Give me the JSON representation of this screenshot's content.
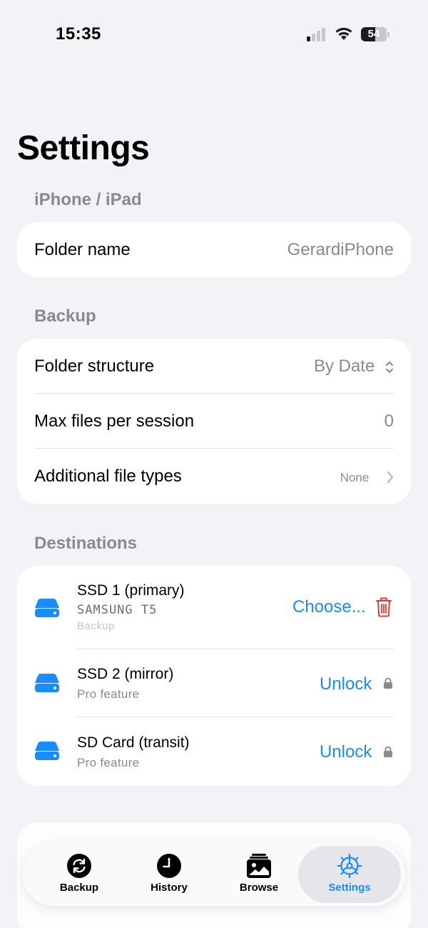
{
  "status_bar": {
    "time": "15:35",
    "battery_level": "54"
  },
  "title": "Settings",
  "sections": {
    "device": {
      "header": "iPhone / iPad",
      "folder_name_label": "Folder name",
      "folder_name_value": "GerardiPhone"
    },
    "backup": {
      "header": "Backup",
      "folder_structure_label": "Folder structure",
      "folder_structure_value": "By Date",
      "max_files_label": "Max files per session",
      "max_files_value": "0",
      "file_types_label": "Additional file types",
      "file_types_value": "None"
    },
    "destinations": {
      "header": "Destinations",
      "items": [
        {
          "name": "SSD 1 (primary)",
          "model": "SAMSUNG T5",
          "role": "Backup",
          "action": "Choose..."
        },
        {
          "name": "SSD 2 (mirror)",
          "sub": "Pro feature",
          "action": "Unlock"
        },
        {
          "name": "SD Card (transit)",
          "sub": "Pro feature",
          "action": "Unlock"
        }
      ]
    }
  },
  "tabbar": {
    "tabs": [
      {
        "label": "Backup",
        "icon": "sync-icon"
      },
      {
        "label": "History",
        "icon": "clock-icon"
      },
      {
        "label": "Browse",
        "icon": "photos-icon"
      },
      {
        "label": "Settings",
        "icon": "gear-icon"
      }
    ],
    "active": "Settings"
  },
  "colors": {
    "accent": "#1a8cff",
    "destructive": "#e5383b",
    "background": "#f2f2f7",
    "secondary_text": "#8a8a8e"
  }
}
